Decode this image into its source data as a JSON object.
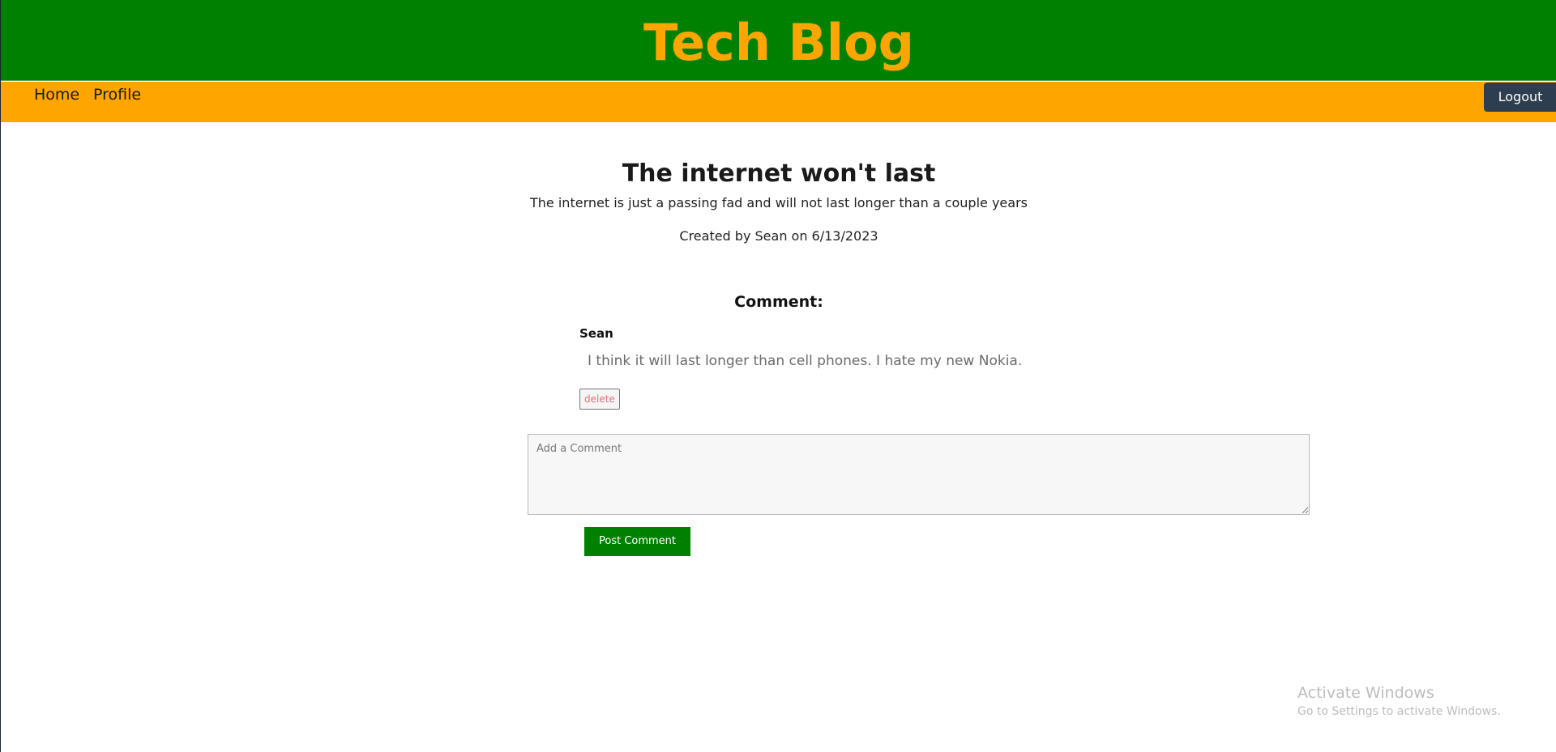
{
  "header": {
    "title": "Tech Blog",
    "background_color": "#008000",
    "title_color": "#ffa500"
  },
  "nav": {
    "background_color": "#ffa500",
    "links": [
      {
        "label": "Home"
      },
      {
        "label": "Profile"
      }
    ],
    "logout_label": "Logout"
  },
  "post": {
    "title": "The internet won't last",
    "body": "The internet is just a passing fad and will not last longer than a couple years",
    "meta": "Created by Sean on 6/13/2023"
  },
  "comments": {
    "heading": "Comment:",
    "items": [
      {
        "author": "Sean",
        "text": "I think it will last longer than cell phones. I hate my new Nokia.",
        "delete_label": "delete"
      }
    ],
    "input_placeholder": "Add a Comment",
    "input_value": "",
    "submit_label": "Post Comment",
    "submit_color": "#008000"
  },
  "os_watermark": {
    "title": "Activate Windows",
    "subtitle": "Go to Settings to activate Windows."
  }
}
